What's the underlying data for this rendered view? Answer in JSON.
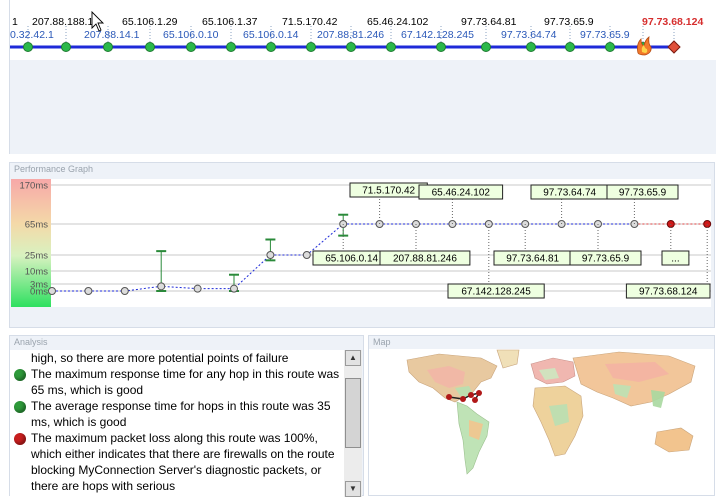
{
  "route": {
    "top_labels": [
      "1",
      "207.88.188.1",
      "65.106.1.29",
      "65.106.1.37",
      "71.5.170.42",
      "65.46.24.102",
      "97.73.64.81",
      "97.73.65.9",
      "97.73.68.124"
    ],
    "bottom_labels": [
      "0.32.42.1",
      "207.88.14.1",
      "65.106.0.10",
      "65.106.0.14",
      "207.88.81.246",
      "67.142.128.245",
      "97.73.64.74",
      "97.73.65.9"
    ],
    "destination": "97.73.68.124",
    "line_color": "#1e2ad8",
    "node_color": "#2bb84a",
    "destination_color": "#d62e2e"
  },
  "performance": {
    "title": "Performance Graph",
    "y_ticks": [
      "170ms",
      "65ms",
      "25ms",
      "10ms",
      "3ms",
      "0ms"
    ],
    "hop_labels": [
      "71.5.170.42",
      "65.46.24.102",
      "97.73.64.74",
      "97.73.65.9",
      "65.106.0.14",
      "207.88.81.246",
      "97.73.64.81",
      "97.73.65.9",
      "...",
      "67.142.128.245",
      "97.73.68.124"
    ]
  },
  "chart_data": {
    "type": "line",
    "title": "Performance Graph",
    "x": [
      1,
      2,
      3,
      4,
      5,
      6,
      7,
      8,
      9,
      10,
      11,
      12,
      13,
      14,
      15,
      16,
      17,
      18,
      19
    ],
    "series": [
      {
        "values": [
          0,
          0,
          0,
          2,
          1,
          1,
          25,
          25,
          65,
          65,
          65,
          65,
          65,
          65,
          65,
          65,
          65,
          65,
          65
        ],
        "ranges": [
          null,
          null,
          null,
          [
            0,
            30
          ],
          null,
          [
            0,
            8
          ],
          [
            20,
            45
          ],
          null,
          [
            50,
            90
          ],
          null,
          null,
          null,
          null,
          null,
          null,
          null,
          null,
          null,
          null
        ],
        "lost": [
          false,
          false,
          false,
          false,
          false,
          false,
          false,
          false,
          false,
          false,
          false,
          false,
          false,
          false,
          false,
          false,
          false,
          true,
          true
        ]
      }
    ],
    "y_ticks": [
      "170ms",
      "65ms",
      "25ms",
      "10ms",
      "3ms",
      "0ms"
    ],
    "y_scale": "nonlinear"
  },
  "analysis": {
    "title": "Analysis",
    "items": [
      {
        "status": "none",
        "text": "high, so there are more potential points of failure"
      },
      {
        "status": "good",
        "text": "The maximum response time for any hop in this route was 65 ms, which is good"
      },
      {
        "status": "good",
        "text": "The average response time for hops in this route was 35 ms, which is good"
      },
      {
        "status": "bad",
        "text": "The maximum packet loss along this route was 100%, which either indicates that there are firewalls on the route blocking MyConnection Server's diagnostic packets, or there are hops with serious"
      }
    ],
    "good_color": "#2e9a3a",
    "bad_color": "#c81e1e",
    "scroll_up": "▲",
    "scroll_down": "▼"
  },
  "map": {
    "title": "Map"
  }
}
